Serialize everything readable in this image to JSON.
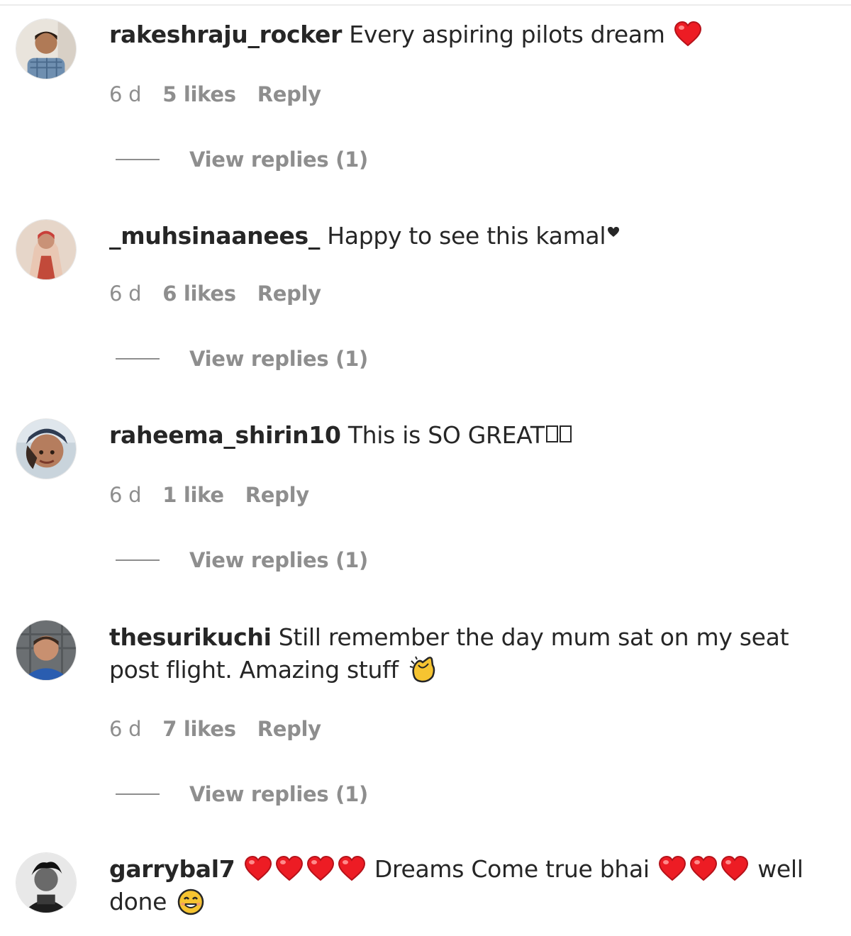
{
  "comments": [
    {
      "username": "rakeshraju_rocker",
      "text": "Every aspiring pilots dream",
      "emoji": "red-heart-icon",
      "age": "6 d",
      "likes": "5 likes",
      "reply": "Reply",
      "view_replies": "View replies (1)"
    },
    {
      "username": "_muhsinaanees_",
      "text": "Happy to see this kamal",
      "emoji": "black-heart-icon",
      "age": "6 d",
      "likes": "6 likes",
      "reply": "Reply",
      "view_replies": "View replies (1)"
    },
    {
      "username": "raheema_shirin10",
      "text": "This is SO GREAT",
      "emoji": "missing-glyph-boxes",
      "age": "6 d",
      "likes": "1 like",
      "reply": "Reply",
      "view_replies": "View replies (1)"
    },
    {
      "username": "thesurikuchi",
      "text": "Still remember the day mum sat on my seat post flight. Amazing stuff",
      "emoji": "clapping-hands-icon",
      "age": "6 d",
      "likes": "7 likes",
      "reply": "Reply",
      "view_replies": "View replies (1)"
    },
    {
      "username": "garrybal7",
      "text_part1": "Dreams Come true bhai",
      "text_part2": "well done",
      "emoji": "red-heart-icon",
      "emoji_end": "smiling-face-icon"
    }
  ],
  "colors": {
    "text": "#262626",
    "secondary": "#8e8e8e",
    "heart": "#ed1c24"
  }
}
